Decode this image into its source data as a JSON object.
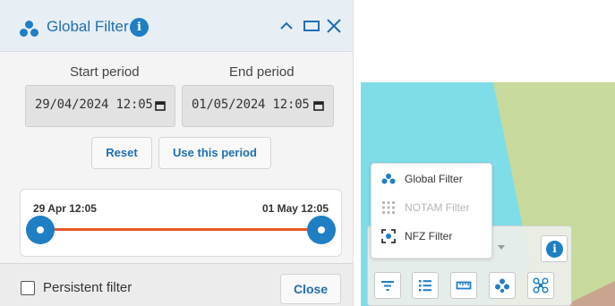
{
  "panel": {
    "title": "Global Filter",
    "start_label": "Start period",
    "end_label": "End period",
    "start_value": "29/04/2024 12:05",
    "end_value": "01/05/2024 12:05",
    "reset_label": "Reset",
    "use_period_label": "Use this period",
    "slider": {
      "start_label": "29 Apr 12:05",
      "end_label": "01 May 12:05",
      "start_fraction": 0.0,
      "end_fraction": 1.0
    },
    "persistent_label": "Persistent filter",
    "persistent_checked": false,
    "close_label": "Close"
  },
  "map": {
    "menu_items": [
      {
        "label": "Global Filter",
        "state": "active",
        "icon": "global-filter-icon"
      },
      {
        "label": "NOTAM Filter",
        "state": "disabled",
        "icon": "notam-grid-icon"
      },
      {
        "label": "NFZ Filter",
        "state": "active",
        "icon": "nfz-focus-icon"
      }
    ],
    "toolbar_icons": [
      "filter-lines-icon",
      "list-icon",
      "ruler-icon",
      "global-filter-icon",
      "drone-icon"
    ]
  },
  "colors": {
    "accent": "#1f7ec4",
    "range": "#e8582d",
    "map_green": "#c6d99a",
    "map_cyan": "#7fdde8"
  }
}
